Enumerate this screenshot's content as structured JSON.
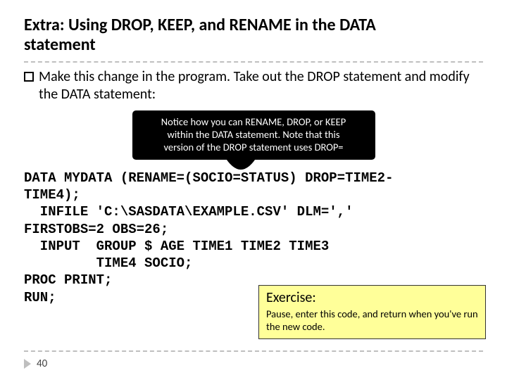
{
  "title": {
    "line1": "Extra: Using DROP, KEEP, and RENAME in the DATA",
    "line2": "statement"
  },
  "bullet": {
    "text": "Make this change in the program. Take out the DROP statement and modify the DATA statement:"
  },
  "callout": {
    "line1": "Notice how you can RENAME, DROP, or KEEP",
    "line2": "within the DATA statement. Note that this",
    "line3": "version of the DROP statement uses DROP="
  },
  "code": "DATA MYDATA (RENAME=(SOCIO=STATUS) DROP=TIME2-\nTIME4);\n  INFILE 'C:\\SASDATA\\EXAMPLE.CSV' DLM=','\nFIRSTOBS=2 OBS=26;\n  INPUT  GROUP $ AGE TIME1 TIME2 TIME3\n         TIME4 SOCIO;\nPROC PRINT;\nRUN;",
  "exercise": {
    "title": "Exercise:",
    "body": "Pause, enter this code, and return when you've run the new code."
  },
  "page_number": "40"
}
